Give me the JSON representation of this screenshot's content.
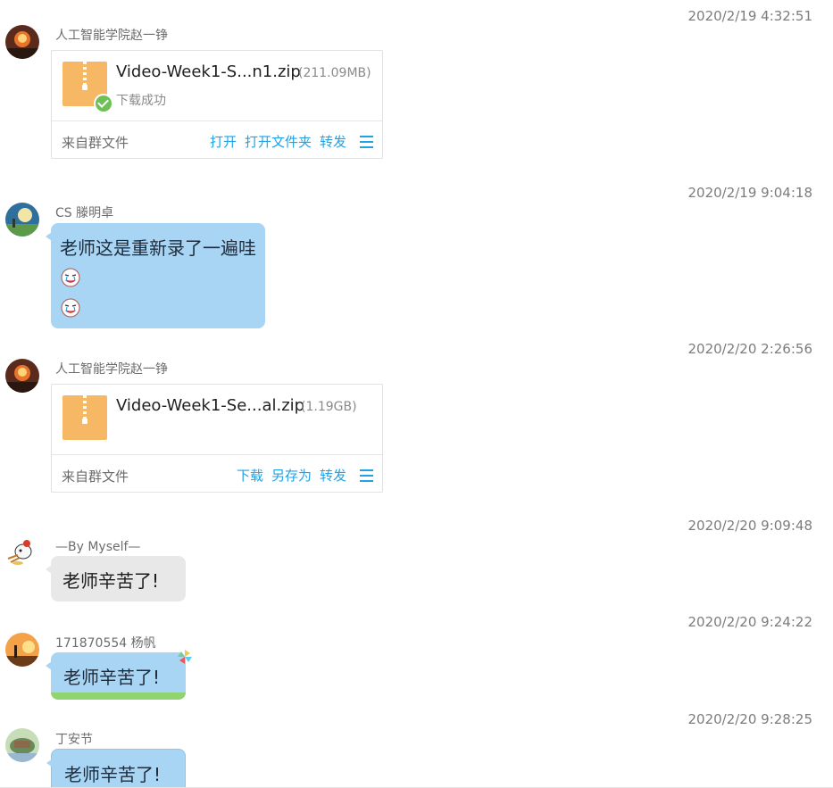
{
  "messages": [
    {
      "timestamp": "2020/2/19 4:32:51",
      "sender": "人工智能学院赵一铮",
      "file": {
        "name": "Video-Week1-S...n1.zip",
        "size": "(211.09MB)",
        "status": "下载成功",
        "source": "来自群文件",
        "actions": [
          "打开",
          "打开文件夹",
          "转发"
        ]
      }
    },
    {
      "timestamp": "2020/2/19 9:04:18",
      "sender": "CS 滕明卓",
      "text": "老师这是重新录了一遍哇"
    },
    {
      "timestamp": "2020/2/20 2:26:56",
      "sender": "人工智能学院赵一铮",
      "file": {
        "name": "Video-Week1-Se...al.zip",
        "size": "(1.19GB)",
        "source": "来自群文件",
        "actions": [
          "下载",
          "另存为",
          "转发"
        ]
      }
    },
    {
      "timestamp": "2020/2/20 9:09:48",
      "sender": "—By Myself—",
      "text": "老师辛苦了!"
    },
    {
      "timestamp": "2020/2/20 9:24:22",
      "sender": "171870554 杨帆",
      "text": "老师辛苦了!"
    },
    {
      "timestamp": "2020/2/20 9:28:25",
      "sender": "丁安节",
      "text": "老师辛苦了!"
    }
  ],
  "colors": {
    "link": "#1fa2e6",
    "bubble_blue": "#a9d5f5",
    "bubble_gray": "#e8e8e8",
    "zip_icon": "#f7b866",
    "success": "#6dc154"
  }
}
